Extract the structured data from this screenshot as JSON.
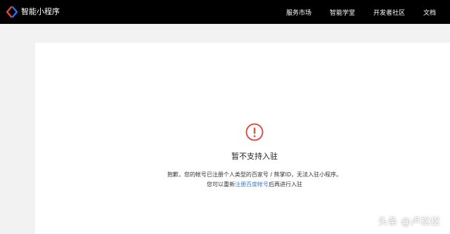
{
  "header": {
    "app_name": "智能小程序",
    "logo_icon": "smart-miniprogram-logo-icon",
    "nav": [
      {
        "label": "服务市场"
      },
      {
        "label": "智能学堂"
      },
      {
        "label": "开发者社区"
      },
      {
        "label": "文档"
      }
    ]
  },
  "main": {
    "status_icon": "warning-circle-icon",
    "title": "暂不支持入驻",
    "message_line1": "抱歉，您的帐号已注册个人类型的百家号 / 熊掌ID，无法入驻小程序。",
    "message_line2_prefix": "您可以重新",
    "message_line2_link": "注册百度帐号",
    "message_line2_suffix": "后再进行入驻"
  },
  "watermark": "头条 @卢松松",
  "colors": {
    "topbar": "#000000",
    "accent_red": "#d9534f",
    "link_blue": "#3a7ee0",
    "background": "#f2f2f2",
    "panel": "#ffffff"
  }
}
